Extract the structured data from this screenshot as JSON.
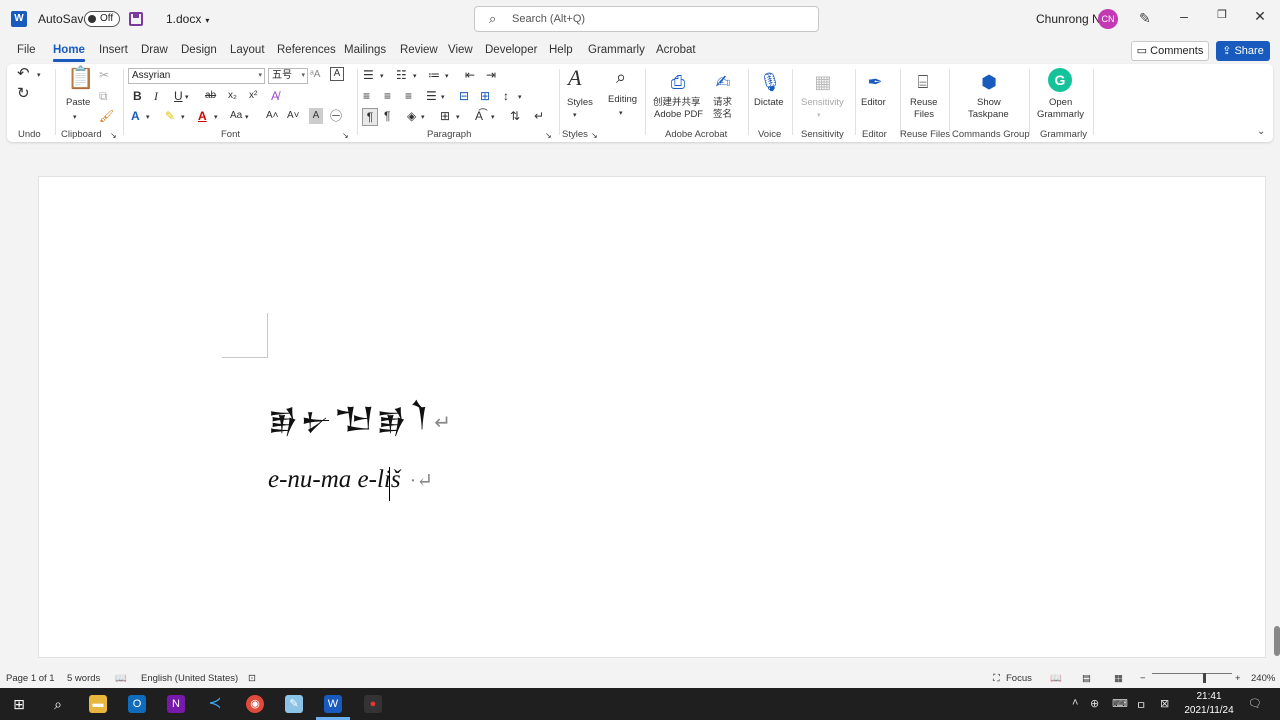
{
  "titlebar": {
    "autosave_label": "AutoSave",
    "autosave_state": "Off",
    "doc_name": "1.docx",
    "search_placeholder": "Search (Alt+Q)",
    "user_name": "Chunrong Ni",
    "user_initials": "CN"
  },
  "menu": {
    "tabs": [
      "File",
      "Home",
      "Insert",
      "Draw",
      "Design",
      "Layout",
      "References",
      "Mailings",
      "Review",
      "View",
      "Developer",
      "Help",
      "Grammarly",
      "Acrobat"
    ],
    "active_tab": "Home",
    "comments_label": "Comments",
    "share_label": "Share"
  },
  "ribbon": {
    "groups": {
      "undo": "Undo",
      "clipboard": "Clipboard",
      "font": "Font",
      "paragraph": "Paragraph",
      "styles": "Styles",
      "adobe_acrobat": "Adobe Acrobat",
      "voice": "Voice",
      "sensitivity": "Sensitivity",
      "editor": "Editor",
      "reuse_files": "Reuse Files",
      "commands_group": "Commands Group",
      "grammarly": "Grammarly"
    },
    "paste_label": "Paste",
    "font_name": "Assyrian",
    "font_size": "五号",
    "styles_label": "Styles",
    "editing_label": "Editing",
    "create_pdf_line1": "创建并共享",
    "create_pdf_line2": "Adobe PDF",
    "request_sign_line1": "请求",
    "request_sign_line2": "签名",
    "dictate_label": "Dictate",
    "sensitivity_label": "Sensitivity",
    "editor_label": "Editor",
    "reuse_line1": "Reuse",
    "reuse_line2": "Files",
    "taskpane_line1": "Show",
    "taskpane_line2": "Taskpane",
    "grammarly_line1": "Open",
    "grammarly_line2": "Grammarly"
  },
  "document": {
    "cuneiform_line": "𒂊𒉡𒈠𒂊𒇺",
    "transliteration_main": "e-nu-ma e-liš"
  },
  "statusbar": {
    "page": "Page 1 of 1",
    "words": "5 words",
    "language": "English (United States)",
    "focus_label": "Focus",
    "zoom": "240%"
  },
  "taskbar": {
    "time": "21:41",
    "date": "2021/11/24"
  },
  "colors": {
    "accent": "#185abd",
    "avatar": "#c239b3",
    "grammarly": "#15c39a"
  }
}
